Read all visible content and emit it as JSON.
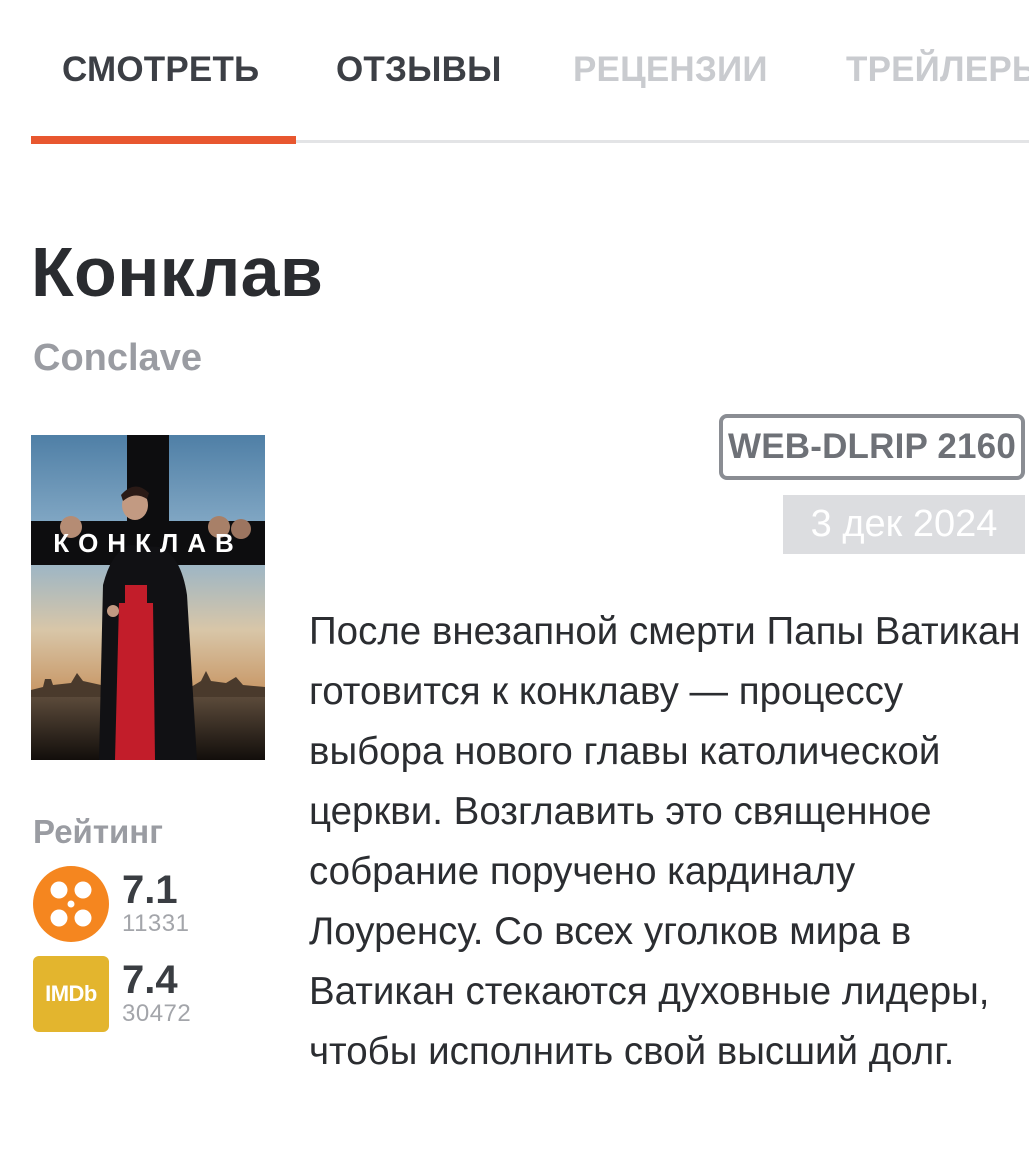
{
  "tabs": [
    {
      "label": "СМОТРЕТЬ",
      "state": "active"
    },
    {
      "label": "ОТЗЫВЫ",
      "state": "normal"
    },
    {
      "label": "РЕЦЕНЗИИ",
      "state": "disabled"
    },
    {
      "label": "ТРЕЙЛЕРЫ",
      "state": "disabled"
    }
  ],
  "movie": {
    "title": "Конклав",
    "original_title": "Conclave",
    "quality": "WEB-DLRIP 2160",
    "date": "3 дек 2024",
    "poster_text": "КОНКЛАВ",
    "description": "После внезапной смерти Папы Ватикан готовится к конклаву — процессу выбора нового главы католической церкви. Возглавить это священное собрание поручено кардиналу Лоуренсу. Со всех уголков мира в Ватикан стекаются духовные лидеры, чтобы исполнить свой высший долг."
  },
  "rating": {
    "label": "Рейтинг",
    "kinopoisk": {
      "icon": "kinopoisk-reel-icon",
      "value": "7.1",
      "votes": "11331"
    },
    "imdb": {
      "icon": "imdb-logo-icon",
      "logo_text": "IMDb",
      "value": "7.4",
      "votes": "30472"
    }
  },
  "colors": {
    "accent": "#e8572f",
    "kinopoisk": "#f5861f",
    "imdb": "#e3b52e"
  }
}
